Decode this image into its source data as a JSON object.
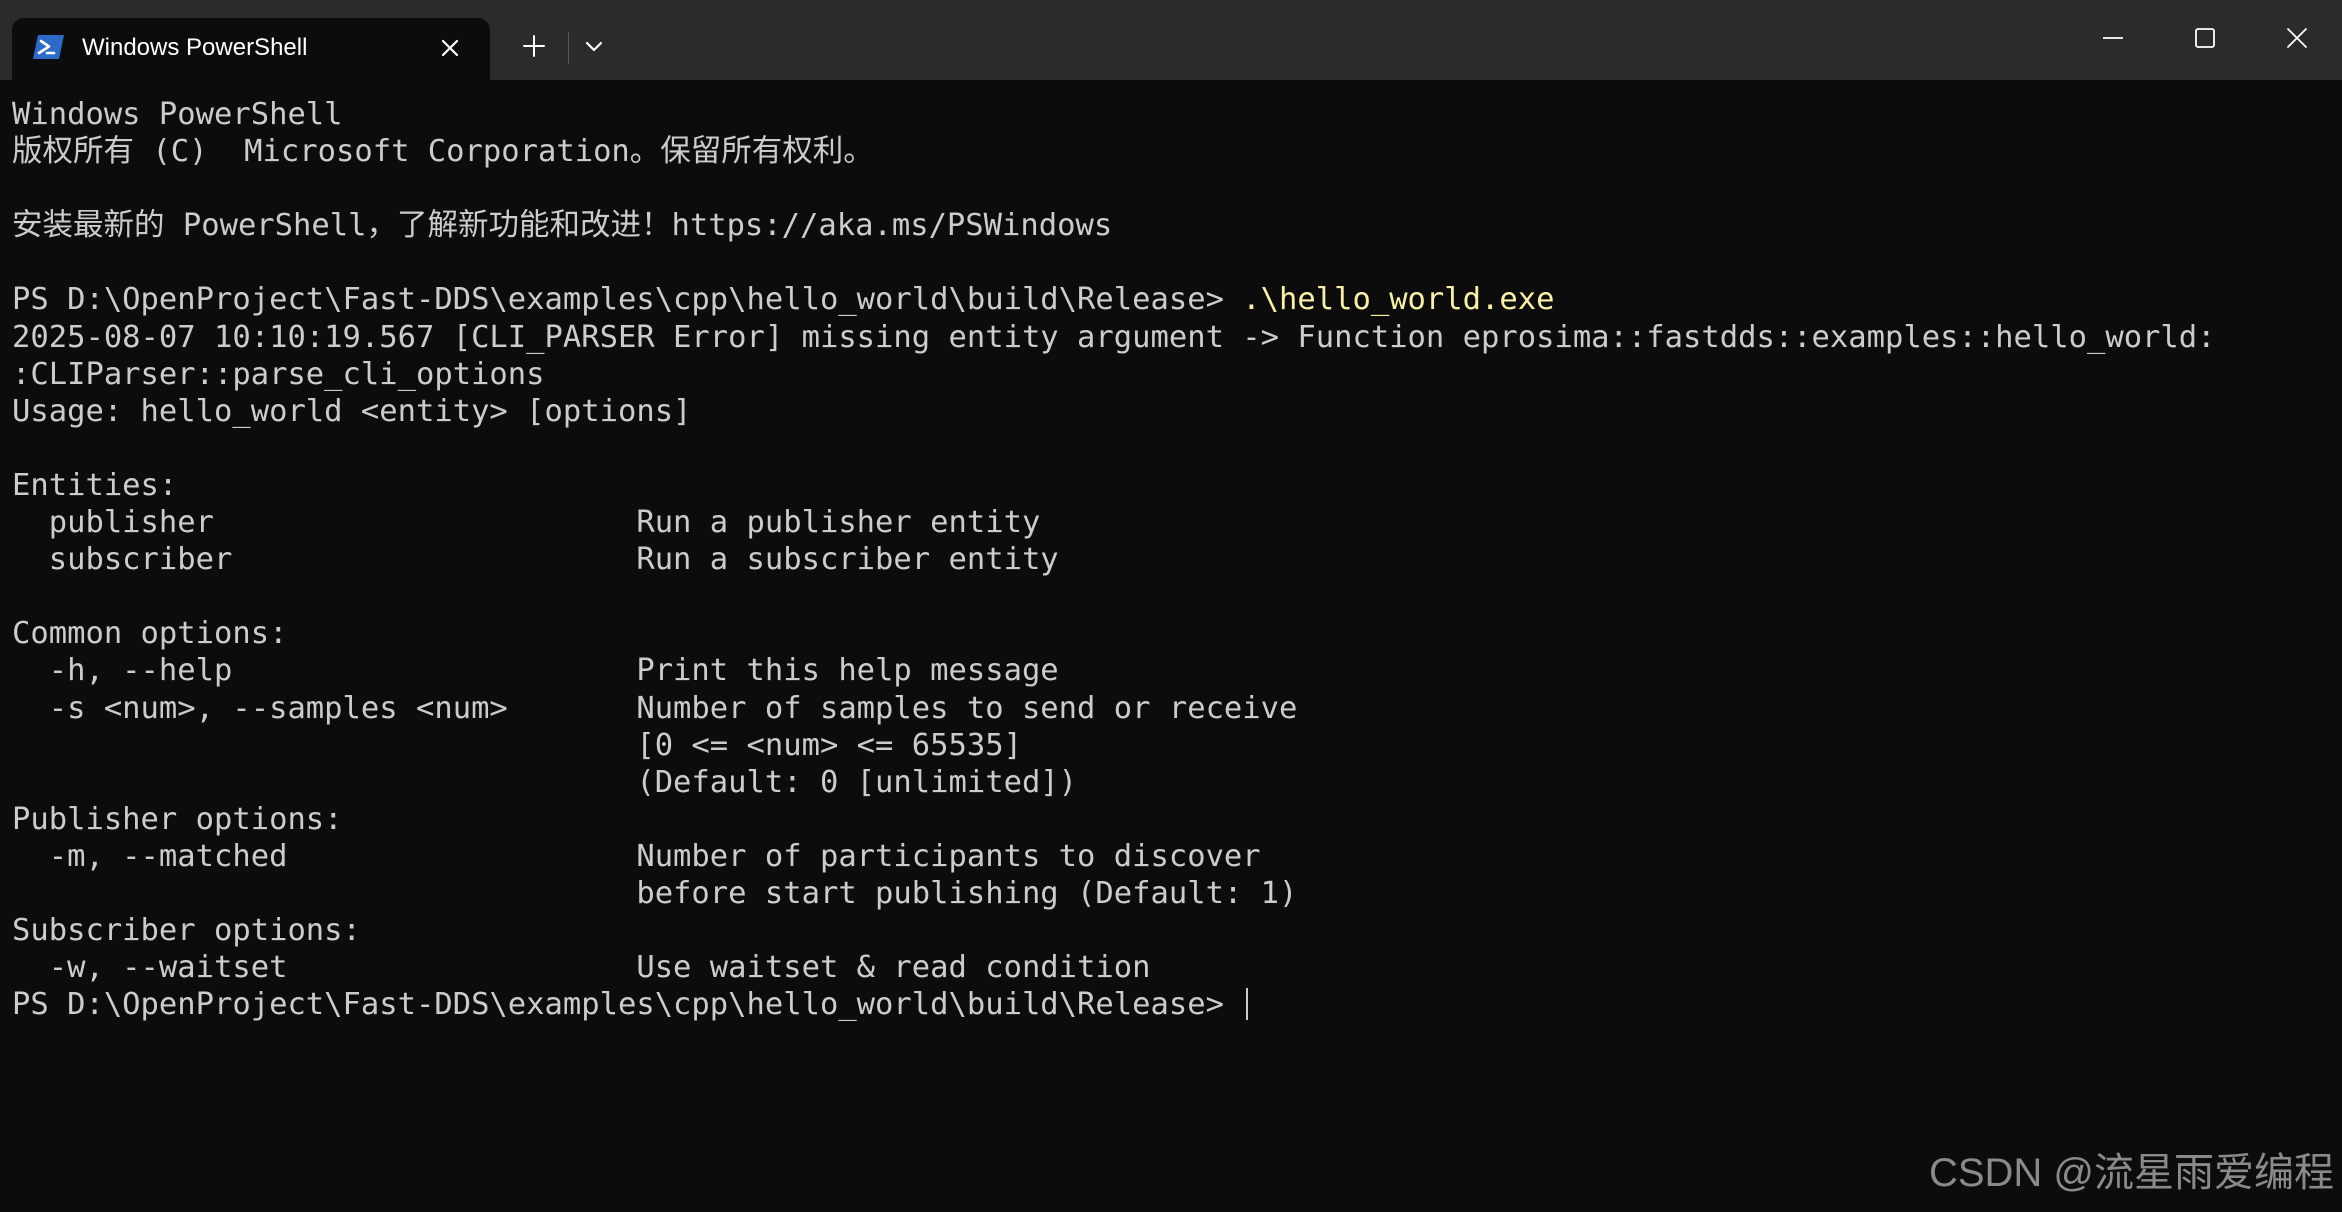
{
  "window": {
    "tab_title": "Windows PowerShell",
    "tab_icon": "powershell-icon",
    "new_tab_icon": "plus-icon",
    "dropdown_icon": "chevron-down-icon",
    "controls": [
      "minimize-icon",
      "maximize-icon",
      "close-icon"
    ]
  },
  "colors": {
    "background": "#0c0c0c",
    "titlebar": "#2b2b2b",
    "text": "#cccccc",
    "command": "#f9f1a5",
    "powershell_blue": "#2d6bc9"
  },
  "terminal": {
    "lines": [
      {
        "text": "Windows PowerShell"
      },
      {
        "text": "版权所有 (C)  Microsoft Corporation。保留所有权利。"
      },
      {
        "text": ""
      },
      {
        "text": "安装最新的 PowerShell，了解新功能和改进！https://aka.ms/PSWindows"
      },
      {
        "text": ""
      },
      {
        "text": "PS D:\\OpenProject\\Fast-DDS\\examples\\cpp\\hello_world\\build\\Release> ",
        "command": ".\\hello_world.exe"
      },
      {
        "text": "2025-08-07 10:10:19.567 [CLI_PARSER Error] missing entity argument -> Function eprosima::fastdds::examples::hello_world:"
      },
      {
        "text": ":CLIParser::parse_cli_options"
      },
      {
        "text": "Usage: hello_world <entity> [options]"
      },
      {
        "text": ""
      },
      {
        "text": "Entities:"
      },
      {
        "text": "  publisher                       Run a publisher entity"
      },
      {
        "text": "  subscriber                      Run a subscriber entity"
      },
      {
        "text": ""
      },
      {
        "text": "Common options:"
      },
      {
        "text": "  -h, --help                      Print this help message"
      },
      {
        "text": "  -s <num>, --samples <num>       Number of samples to send or receive"
      },
      {
        "text": "                                  [0 <= <num> <= 65535]"
      },
      {
        "text": "                                  (Default: 0 [unlimited])"
      },
      {
        "text": "Publisher options:"
      },
      {
        "text": "  -m, --matched                   Number of participants to discover"
      },
      {
        "text": "                                  before start publishing (Default: 1)"
      },
      {
        "text": "Subscriber options:"
      },
      {
        "text": "  -w, --waitset                   Use waitset & read condition"
      },
      {
        "text": "PS D:\\OpenProject\\Fast-DDS\\examples\\cpp\\hello_world\\build\\Release> ",
        "cursor": true
      }
    ]
  },
  "watermark": "CSDN @流星雨爱编程"
}
